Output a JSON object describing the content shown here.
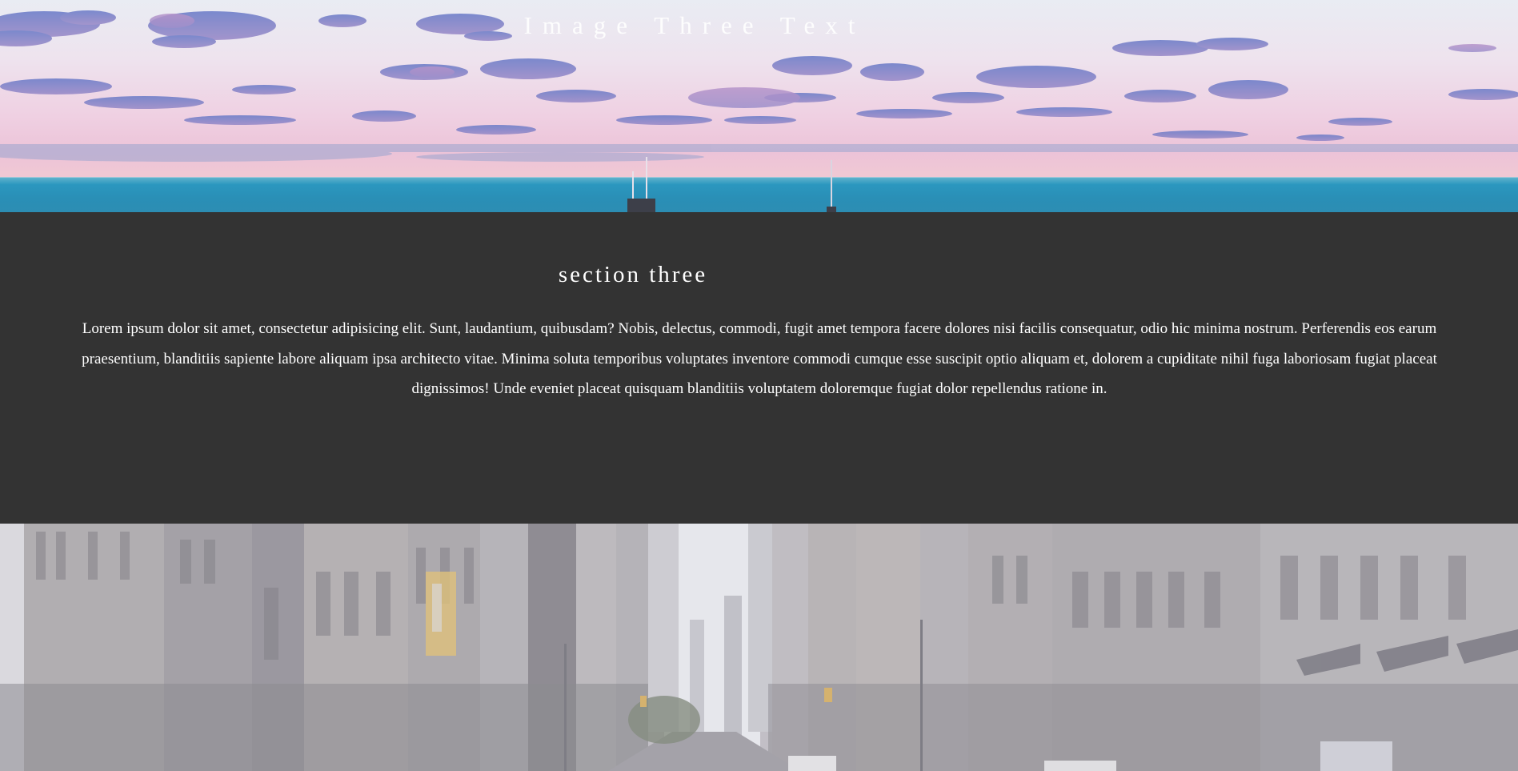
{
  "hero": {
    "title": "Image Three Text",
    "image": "sky-ocean-skyline-photo"
  },
  "section": {
    "title": "section three",
    "body": "Lorem ipsum dolor sit amet, consectetur adipisicing elit. Sunt, laudantium, quibusdam? Nobis, delectus, commodi, fugit amet tempora facere dolores nisi facilis consequatur, odio hic minima nostrum. Perferendis eos earum praesentium, blanditiis sapiente labore aliquam ipsa architecto vitae. Minima soluta temporibus voluptates inventore commodi cumque esse suscipit optio aliquam et, dolorem a cupiditate nihil fuga laboriosam fugiat placeat dignissimos! Unde eveniet placeat quisquam blanditiis voluptatem doloremque fugiat dolor repellendus ratione in."
  },
  "city": {
    "image": "city-street-photo"
  },
  "colors": {
    "section_background": "#333333",
    "text": "#ffffff",
    "ocean": "#2a8fb6"
  }
}
